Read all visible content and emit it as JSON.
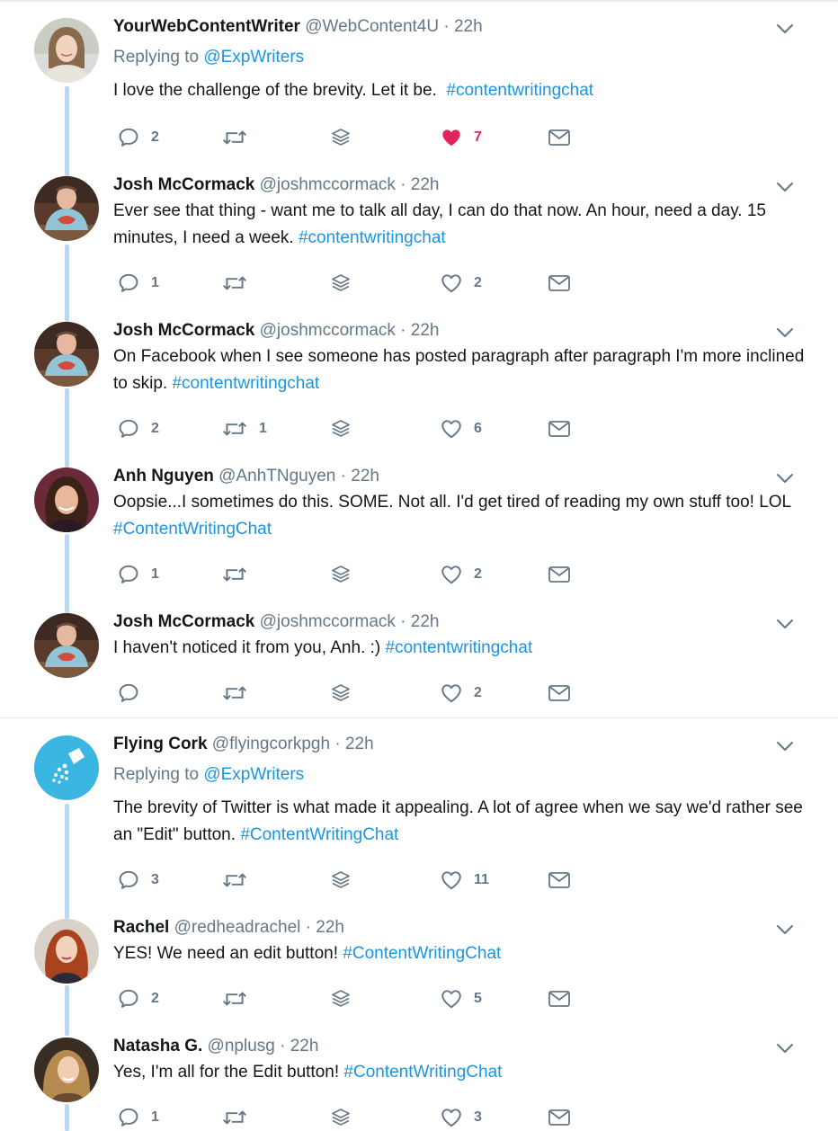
{
  "colors": {
    "accent": "#1b95e0",
    "like_active": "#e0245e",
    "thread": "#bcd8ee",
    "muted": "#657786"
  },
  "tweets": [
    {
      "name": "YourWebContentWriter",
      "handle": "@WebContent4U",
      "time": "22h",
      "replying_label": "Replying to",
      "replying_to": "@ExpWriters",
      "text": "I love the challenge of the brevity. Let it be.  ",
      "hashtag": "#contentwritingchat",
      "replies": "2",
      "retweets": "",
      "likes": "7",
      "liked": true,
      "avatar": "woman-brown-hair"
    },
    {
      "name": "Josh McCormack",
      "handle": "@joshmccormack",
      "time": "22h",
      "text": "Ever see that thing - want me to talk all day, I can do that now. An hour, need a day. 15 minutes, I need a week. ",
      "hashtag": "#contentwritingchat",
      "replies": "1",
      "retweets": "",
      "likes": "2",
      "liked": false,
      "avatar": "man-lobster-shirt"
    },
    {
      "name": "Josh McCormack",
      "handle": "@joshmccormack",
      "time": "22h",
      "text": "On Facebook when I see someone has posted paragraph after paragraph I'm more inclined to skip. ",
      "hashtag": "#contentwritingchat",
      "replies": "2",
      "retweets": "1",
      "likes": "6",
      "liked": false,
      "avatar": "man-lobster-shirt"
    },
    {
      "name": "Anh Nguyen",
      "handle": "@AnhTNguyen",
      "time": "22h",
      "text": "Oopsie...I sometimes do this. SOME. Not all. I'd get tired of reading my own stuff too! LOL ",
      "hashtag": "#ContentWritingChat",
      "replies": "1",
      "retweets": "",
      "likes": "2",
      "liked": false,
      "avatar": "woman-dark-hair"
    },
    {
      "name": "Josh McCormack",
      "handle": "@joshmccormack",
      "time": "22h",
      "text": "I haven't noticed it from you, Anh. :) ",
      "hashtag": "#contentwritingchat",
      "replies": "",
      "retweets": "",
      "likes": "2",
      "liked": false,
      "avatar": "man-lobster-shirt"
    },
    {
      "name": "Flying Cork",
      "handle": "@flyingcorkpgh",
      "time": "22h",
      "replying_label": "Replying to",
      "replying_to": "@ExpWriters",
      "text": "The brevity of Twitter is what made it appealing. A lot of agree when we say we'd rather see an \"Edit\" button. ",
      "hashtag": "#ContentWritingChat",
      "replies": "3",
      "retweets": "",
      "likes": "11",
      "liked": false,
      "avatar": "cork-logo"
    },
    {
      "name": "Rachel",
      "handle": "@redheadrachel",
      "time": "22h",
      "text": "YES! We need an edit button! ",
      "hashtag": "#ContentWritingChat",
      "replies": "2",
      "retweets": "",
      "likes": "5",
      "liked": false,
      "avatar": "woman-red-hair"
    },
    {
      "name": "Natasha G.",
      "handle": "@nplusg",
      "time": "22h",
      "text": "Yes, I'm all for the Edit button! ",
      "hashtag": "#ContentWritingChat",
      "replies": "1",
      "retweets": "",
      "likes": "3",
      "liked": false,
      "avatar": "woman-blonde-hair"
    }
  ]
}
